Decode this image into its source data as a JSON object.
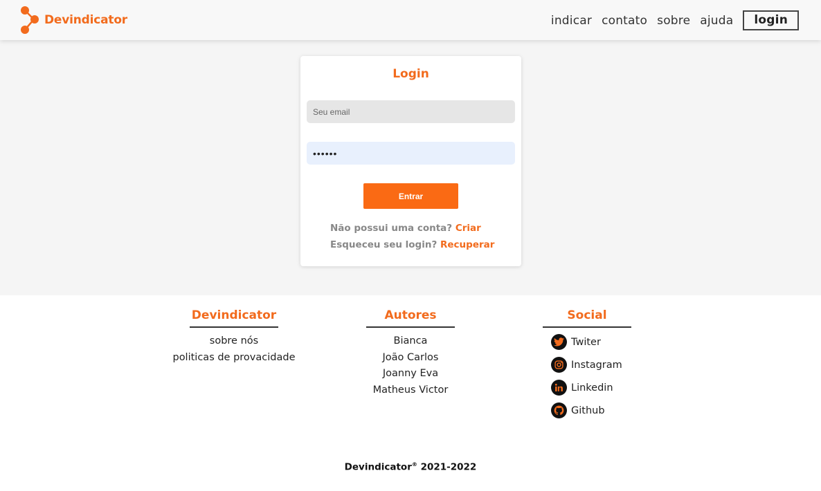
{
  "brand": {
    "name": "Devindicator",
    "accent_color": "#f26b1d",
    "logo_icon": "molecule-dots-icon"
  },
  "nav": {
    "items": [
      "indicar",
      "contato",
      "sobre",
      "ajuda"
    ],
    "login_label": "login"
  },
  "login_card": {
    "title": "Login",
    "email_placeholder": "Seu email",
    "email_value": "",
    "password_value": "••••••",
    "submit_label": "Entrar",
    "no_account_text": "Não possui uma conta?",
    "create_link": "Criar",
    "forgot_text": "Esqueceu seu login?",
    "recover_link": "Recuperar",
    "button_color": "#fa6a14"
  },
  "footer": {
    "columns": [
      {
        "title": "Devindicator",
        "items": [
          "sobre nós",
          "politicas de provacidade"
        ]
      },
      {
        "title": "Autores",
        "items": [
          "Bianca",
          "João Carlos",
          "Joanny Eva",
          "Matheus Victor"
        ]
      },
      {
        "title": "Social",
        "items": [
          {
            "label": "Twiter",
            "icon": "twitter-icon"
          },
          {
            "label": "Instagram",
            "icon": "instagram-icon"
          },
          {
            "label": "Linkedin",
            "icon": "linkedin-icon"
          },
          {
            "label": "Github",
            "icon": "github-icon"
          }
        ]
      }
    ],
    "copyright_name": "Devindicator",
    "copyright_mark": "®",
    "copyright_years": "2021-2022"
  }
}
